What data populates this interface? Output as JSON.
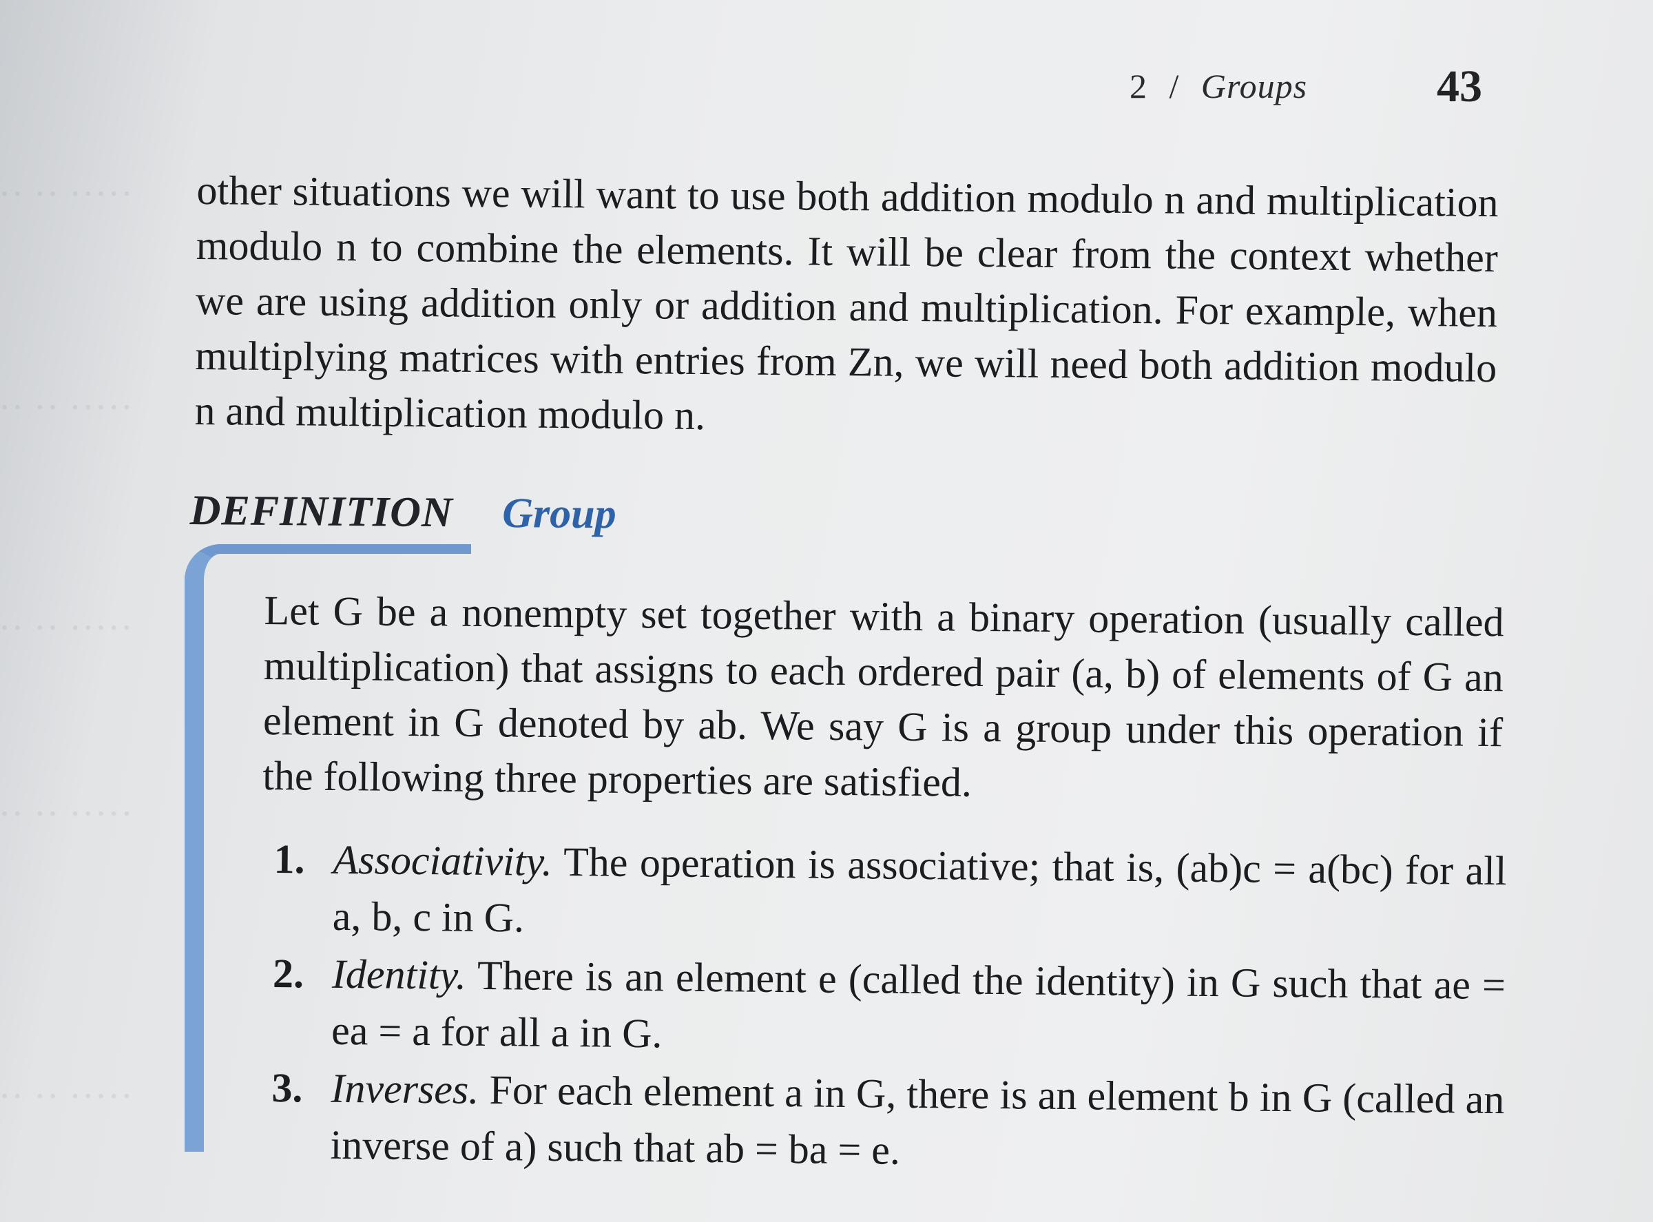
{
  "running_head": {
    "chapter": "2",
    "separator": "/",
    "section": "Groups"
  },
  "page_number": "43",
  "intro": {
    "text": "other situations we will want to use both addition modulo n and multiplication modulo n to combine the elements. It will be clear from the context whether we are using addition only or addition and multiplication. For example, when multiplying matrices with entries from Zn, we will need both addition modulo n and multiplication modulo n."
  },
  "definition": {
    "label": "DEFINITION",
    "term": "Group",
    "statement": "Let G be a nonempty set together with a binary operation (usually called multiplication) that assigns to each ordered pair (a, b) of elements of G an element in G denoted by ab. We say G is a group under this operation if the following three properties are satisfied.",
    "properties": [
      {
        "number": "1.",
        "name": "Associativity.",
        "text": "The operation is associative; that is, (ab)c = a(bc) for all a, b, c in G."
      },
      {
        "number": "2.",
        "name": "Identity.",
        "text": "There is an element e (called the identity) in G such that ae = ea = a for all a in G."
      },
      {
        "number": "3.",
        "name": "Inverses.",
        "text": "For each element a in G, there is an element b in G (called an inverse of a) such that ab = ba = e."
      }
    ]
  },
  "colors": {
    "accent_blue": "#2f63a8",
    "box_rule": "#7ba3d6",
    "paper": "#eeeff0",
    "ink": "#1c1d20"
  }
}
